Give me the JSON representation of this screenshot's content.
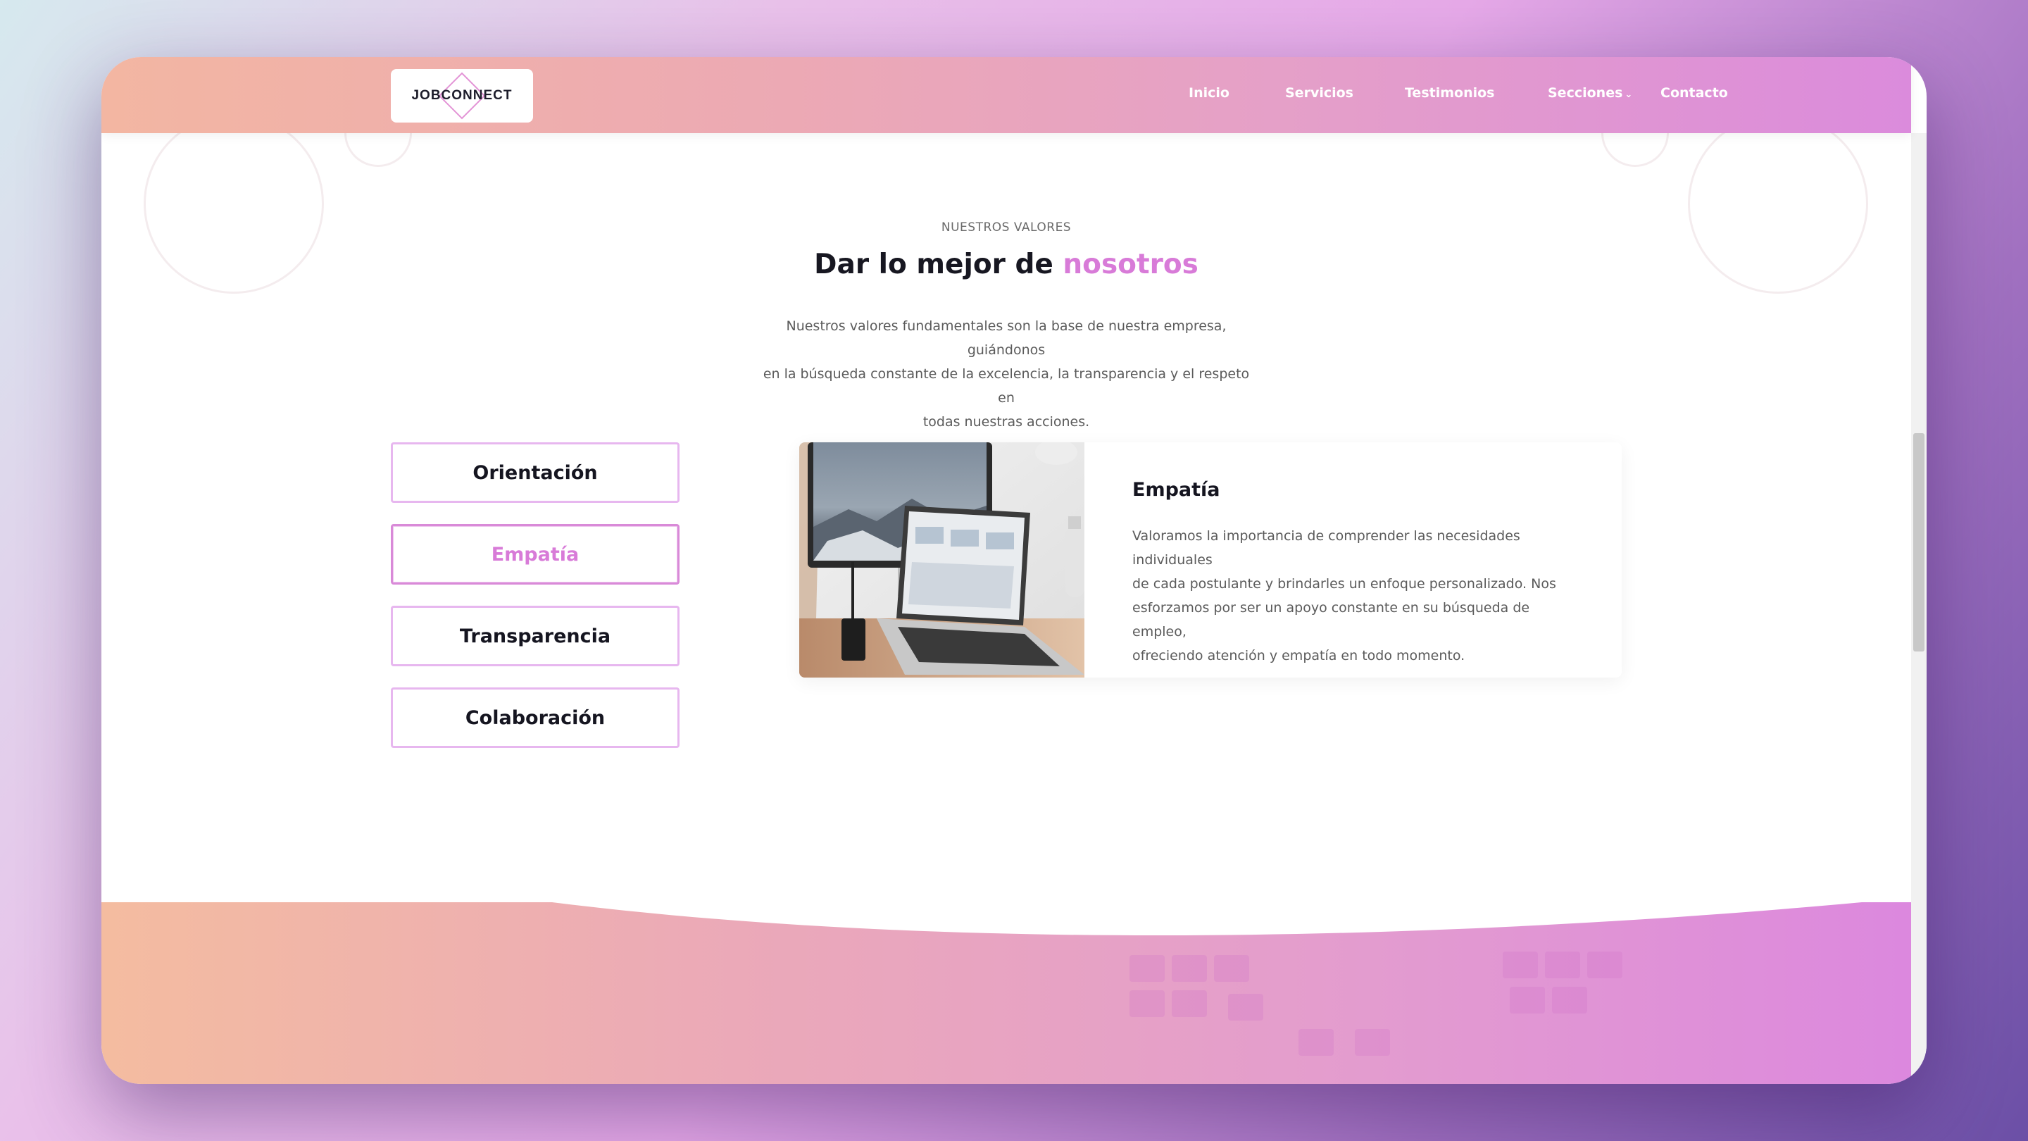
{
  "navbar": {
    "logo_text": "JOBCONNECT",
    "items": [
      {
        "label": "Inicio"
      },
      {
        "label": "Servicios"
      },
      {
        "label": "Testimonios"
      },
      {
        "label": "Secciones"
      },
      {
        "label": "Contacto"
      }
    ]
  },
  "values_section": {
    "eyebrow": "NUESTROS VALORES",
    "title_main": "Dar lo mejor de ",
    "title_accent": "nosotros",
    "description_lines": [
      "Nuestros valores fundamentales son la base de nuestra empresa, guiándonos",
      "en la búsqueda constante de la excelencia, la transparencia y el respeto en",
      "todas nuestras acciones."
    ],
    "tabs": [
      {
        "label": "Orientación",
        "active": false
      },
      {
        "label": "Empatía",
        "active": true
      },
      {
        "label": "Transparencia",
        "active": false
      },
      {
        "label": "Colaboración",
        "active": false
      }
    ],
    "card": {
      "title": "Empatía",
      "text_lines": [
        "Valoramos la importancia de comprender las necesidades individuales",
        "de cada postulante y brindarles un enfoque personalizado. Nos",
        "esforzamos por ser un apoyo constante en su búsqueda de empleo,",
        "ofreciendo atención y empatía en todo momento."
      ]
    }
  },
  "colors": {
    "accent": "#d87bd8",
    "nav_gradient_start": "#f3b6a2",
    "nav_gradient_end": "#db8bdc",
    "tab_border": "#e7b7ef",
    "heading": "#171721",
    "body_text": "#5b5b5b"
  },
  "icons": {
    "dropdown": "chevron-down-icon",
    "logo": "diamond-logo-icon"
  }
}
